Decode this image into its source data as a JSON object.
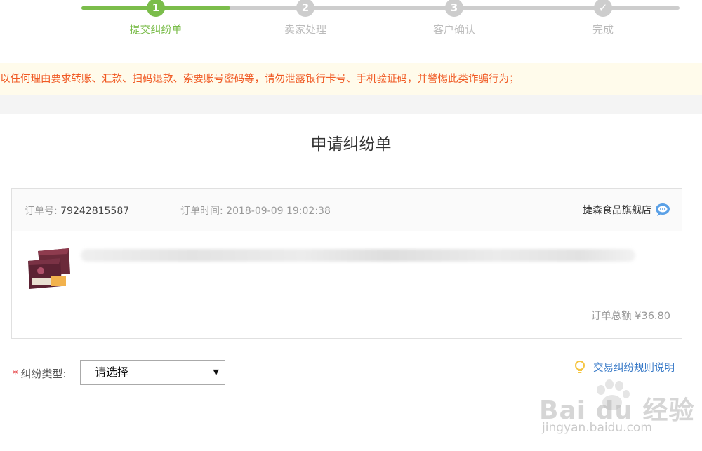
{
  "steps": [
    {
      "num": "1",
      "label": "提交纠纷单",
      "state": "active"
    },
    {
      "num": "2",
      "label": "卖家处理",
      "state": "pending"
    },
    {
      "num": "3",
      "label": "客户确认",
      "state": "pending"
    },
    {
      "num": "✓",
      "label": "完成",
      "state": "pending"
    }
  ],
  "warning": "以任何理由要求转账、汇款、扫码退款、索要账号密码等，请勿泄露银行卡号、手机验证码，并警惕此类诈骗行为；",
  "page_title": "申请纠纷单",
  "order": {
    "id_label": "订单号:",
    "id_value": "79242815587",
    "time_label": "订单时间:",
    "time_value": "2018-09-09 19:02:38",
    "shop_name": "捷森食品旗舰店",
    "total_label": "订单总额",
    "total_value": "¥36.80"
  },
  "form": {
    "required_mark": "*",
    "type_label": "纠纷类型:",
    "type_select_value": "请选择",
    "rules_link": "交易纠纷规则说明"
  },
  "watermark": {
    "main": "Bai du 经验",
    "sub": "jingyan.baidu.com"
  },
  "colors": {
    "accent_green": "#7bbd4b",
    "warning_text": "#f05a24",
    "link_blue": "#3a7bc8",
    "required_red": "#e4393c"
  }
}
